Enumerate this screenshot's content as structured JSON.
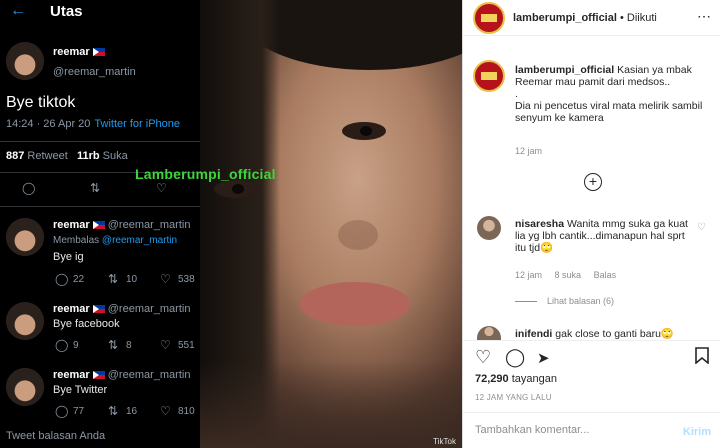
{
  "twitter": {
    "back_icon": "arrow-left-icon",
    "title": "Utas",
    "main_tweet": {
      "name": "reemar",
      "handle": "@reemar_martin",
      "text": "Bye tiktok",
      "time": "14:24 · 26 Apr 20",
      "source": "Twitter for iPhone",
      "retweets_count": "887",
      "retweets_label": "Retweet",
      "likes_count": "11rb",
      "likes_label": "Suka"
    },
    "replies": [
      {
        "name": "reemar",
        "handle": "@reemar_martin",
        "replying_label": "Membalas",
        "replying_to": "@reemar_martin",
        "text": "Bye ig",
        "reply_count": "22",
        "retweet_count": "10",
        "like_count": "538"
      },
      {
        "name": "reemar",
        "handle": "@reemar_martin",
        "text": "Bye facebook",
        "reply_count": "9",
        "retweet_count": "8",
        "like_count": "551"
      },
      {
        "name": "reemar",
        "handle": "@reemar_martin",
        "text": "Bye Twitter",
        "reply_count": "77",
        "retweet_count": "16",
        "like_count": "810"
      }
    ],
    "footer": "Tweet balasan Anda"
  },
  "video": {
    "watermark": "Lamberumpi_official",
    "tiktok_mark": "TikTok"
  },
  "instagram": {
    "header": {
      "username": "lamberumpi_official",
      "separator": "•",
      "follow_status": "Diikuti",
      "more_icon": "more-dots-icon"
    },
    "caption": {
      "username": "lamberumpi_official",
      "line1": "Kasian ya mbak Reemar mau pamit dari medsos..",
      "line2": ".",
      "line3": "Dia ni pencetus viral mata melirik sambil senyum ke kamera",
      "time": "12 jam"
    },
    "add_icon": "plus-circle-icon",
    "comment": {
      "username": "nisaresha",
      "text": "Wanita mmg suka ga kuat lia yg lbh cantik...dimanapun hal sprt itu tjd🙄",
      "time": "12 jam",
      "likes": "8 suka",
      "reply_label": "Balas",
      "view_replies": "Lihat balasan (6)"
    },
    "comment2": {
      "username": "inifendi",
      "text": "gak close to ganti baru🙄"
    },
    "views_count": "72,290",
    "views_label": "tayangan",
    "time_ago": "12 JAM YANG LALU",
    "comment_placeholder": "Tambahkan komentar...",
    "send_label": "Kirim",
    "colors": {
      "link_blue": "#0095f6",
      "send_disabled": "#b2dffc",
      "watermark_green": "#3ed63a",
      "twitter_blue": "#1d9bf0"
    }
  }
}
